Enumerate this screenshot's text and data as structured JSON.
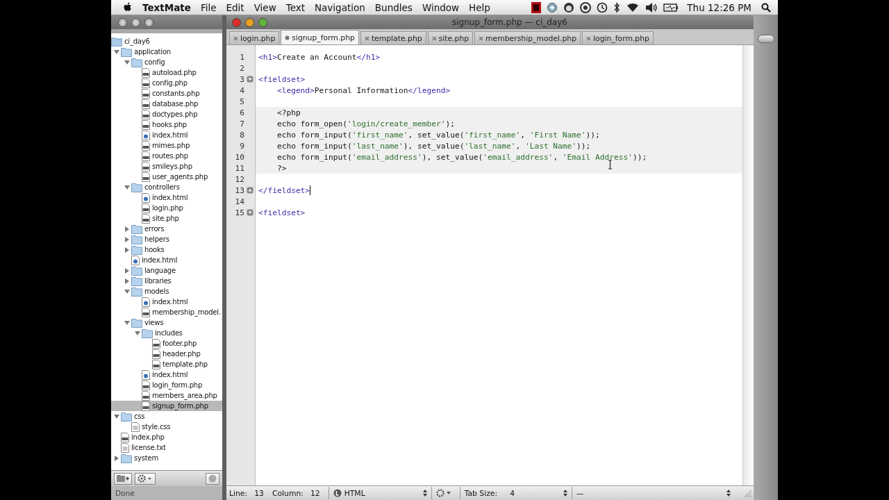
{
  "menu_bar": {
    "app": "TextMate",
    "items": [
      "File",
      "Edit",
      "View",
      "Text",
      "Navigation",
      "Bundles",
      "Window",
      "Help"
    ],
    "clock": "Thu 12:26 PM"
  },
  "window": {
    "title": "signup_form.php — ci_day6"
  },
  "tabs": [
    {
      "label": "login.php",
      "selected": false,
      "modified": false
    },
    {
      "label": "signup_form.php",
      "selected": true,
      "modified": true
    },
    {
      "label": "template.php",
      "selected": false,
      "modified": false
    },
    {
      "label": "site.php",
      "selected": false,
      "modified": false
    },
    {
      "label": "membership_model.php",
      "selected": false,
      "modified": false
    },
    {
      "label": "login_form.php",
      "selected": false,
      "modified": false
    }
  ],
  "project": {
    "name": "ci_day6",
    "tree": [
      {
        "label": "application",
        "kind": "folder",
        "expanded": true,
        "children": [
          {
            "label": "config",
            "kind": "folder",
            "expanded": true,
            "children": [
              {
                "label": "autoload.php",
                "kind": "php",
                "selected": false
              },
              {
                "label": "config.php",
                "kind": "php",
                "selected": false
              },
              {
                "label": "constants.php",
                "kind": "php",
                "selected": false
              },
              {
                "label": "database.php",
                "kind": "php",
                "selected": false
              },
              {
                "label": "doctypes.php",
                "kind": "php",
                "selected": false
              },
              {
                "label": "hooks.php",
                "kind": "php",
                "selected": false
              },
              {
                "label": "index.html",
                "kind": "html",
                "selected": false
              },
              {
                "label": "mimes.php",
                "kind": "php",
                "selected": false
              },
              {
                "label": "routes.php",
                "kind": "php",
                "selected": false
              },
              {
                "label": "smileys.php",
                "kind": "php",
                "selected": false
              },
              {
                "label": "user_agents.php",
                "kind": "php",
                "selected": false
              }
            ]
          },
          {
            "label": "controllers",
            "kind": "folder",
            "expanded": true,
            "children": [
              {
                "label": "index.html",
                "kind": "html",
                "selected": false
              },
              {
                "label": "login.php",
                "kind": "php",
                "selected": false
              },
              {
                "label": "site.php",
                "kind": "php",
                "selected": false
              }
            ]
          },
          {
            "label": "errors",
            "kind": "folder",
            "expanded": false
          },
          {
            "label": "helpers",
            "kind": "folder",
            "expanded": false
          },
          {
            "label": "hooks",
            "kind": "folder",
            "expanded": false
          },
          {
            "label": "index.html",
            "kind": "html",
            "selected": false
          },
          {
            "label": "language",
            "kind": "folder",
            "expanded": false
          },
          {
            "label": "libraries",
            "kind": "folder",
            "expanded": false
          },
          {
            "label": "models",
            "kind": "folder",
            "expanded": true,
            "children": [
              {
                "label": "index.html",
                "kind": "html",
                "selected": false
              },
              {
                "label": "membership_model.",
                "kind": "php",
                "selected": false
              }
            ]
          },
          {
            "label": "views",
            "kind": "folder",
            "expanded": true,
            "children": [
              {
                "label": "includes",
                "kind": "folder",
                "expanded": true,
                "children": [
                  {
                    "label": "footer.php",
                    "kind": "php",
                    "selected": false
                  },
                  {
                    "label": "header.php",
                    "kind": "php",
                    "selected": false
                  },
                  {
                    "label": "template.php",
                    "kind": "php",
                    "selected": false
                  }
                ]
              },
              {
                "label": "index.html",
                "kind": "html",
                "selected": false
              },
              {
                "label": "login_form.php",
                "kind": "php",
                "selected": false
              },
              {
                "label": "members_area.php",
                "kind": "php",
                "selected": false
              },
              {
                "label": "signup_form.php",
                "kind": "php",
                "selected": true
              }
            ]
          }
        ]
      },
      {
        "label": "css",
        "kind": "folder",
        "expanded": true,
        "children": [
          {
            "label": "style.css",
            "kind": "text",
            "selected": false
          }
        ]
      },
      {
        "label": "index.php",
        "kind": "php",
        "selected": false
      },
      {
        "label": "license.txt",
        "kind": "text",
        "selected": false
      },
      {
        "label": "system",
        "kind": "folder",
        "expanded": false
      }
    ],
    "status": "Done"
  },
  "editor": {
    "lines": [
      {
        "number": "1",
        "tokens": [
          {
            "kind": "tag",
            "text": "<h1>"
          },
          {
            "kind": "text",
            "text": "Create an Account"
          },
          {
            "kind": "tag",
            "text": "</h1>"
          }
        ]
      },
      {
        "number": "2"
      },
      {
        "number": "3",
        "fold_start": true,
        "tokens": [
          {
            "kind": "tag",
            "text": "<fieldset>"
          }
        ]
      },
      {
        "number": "4",
        "tokens": [
          {
            "kind": "tag",
            "text": "    <legend>"
          },
          {
            "kind": "text",
            "text": "Personal Information"
          },
          {
            "kind": "tag",
            "text": "</legend>"
          }
        ]
      },
      {
        "number": "5"
      },
      {
        "number": "6",
        "embedded": true,
        "tokens": [
          {
            "kind": "text",
            "text": "    <?php"
          }
        ]
      },
      {
        "number": "7",
        "embedded": true,
        "tokens": [
          {
            "kind": "text",
            "text": "    echo form_open("
          },
          {
            "kind": "string",
            "text": "'login/create_member'"
          },
          {
            "kind": "text",
            "text": ");"
          }
        ]
      },
      {
        "number": "8",
        "embedded": true,
        "tokens": [
          {
            "kind": "text",
            "text": "    echo form_input("
          },
          {
            "kind": "string",
            "text": "'first_name'"
          },
          {
            "kind": "text",
            "text": ", set_value("
          },
          {
            "kind": "string",
            "text": "'first_name'"
          },
          {
            "kind": "text",
            "text": ", "
          },
          {
            "kind": "string",
            "text": "'First Name'"
          },
          {
            "kind": "text",
            "text": "));"
          }
        ]
      },
      {
        "number": "9",
        "embedded": true,
        "tokens": [
          {
            "kind": "text",
            "text": "    echo form_input("
          },
          {
            "kind": "string",
            "text": "'last_name'"
          },
          {
            "kind": "text",
            "text": "), set_value("
          },
          {
            "kind": "string",
            "text": "'last_name'"
          },
          {
            "kind": "text",
            "text": ", "
          },
          {
            "kind": "string",
            "text": "'Last Name'"
          },
          {
            "kind": "text",
            "text": "));"
          }
        ]
      },
      {
        "number": "10",
        "embedded": true,
        "tokens": [
          {
            "kind": "text",
            "text": "    echo form_input("
          },
          {
            "kind": "string",
            "text": "'email_address'"
          },
          {
            "kind": "text",
            "text": "), set_value("
          },
          {
            "kind": "string",
            "text": "'email_address'"
          },
          {
            "kind": "text",
            "text": ", "
          },
          {
            "kind": "string",
            "text": "'Email Address'"
          },
          {
            "kind": "text",
            "text": "));"
          }
        ]
      },
      {
        "number": "11",
        "embedded": true,
        "tokens": [
          {
            "kind": "text",
            "text": "    ?>"
          }
        ]
      },
      {
        "number": "12"
      },
      {
        "number": "13",
        "fold_end": true,
        "cursor": true,
        "tokens": [
          {
            "kind": "tag",
            "text": "</fieldset>"
          }
        ]
      },
      {
        "number": "14"
      },
      {
        "number": "15",
        "fold_start": true,
        "tokens": [
          {
            "kind": "tag",
            "text": "<fieldset>"
          }
        ]
      }
    ]
  },
  "status_bar": {
    "line_label": "Line:",
    "line": "13",
    "column_label": "Column:",
    "column": "12",
    "language": "HTML",
    "tab_size_label": "Tab Size:",
    "tab_size": "4",
    "symbol": "—"
  }
}
